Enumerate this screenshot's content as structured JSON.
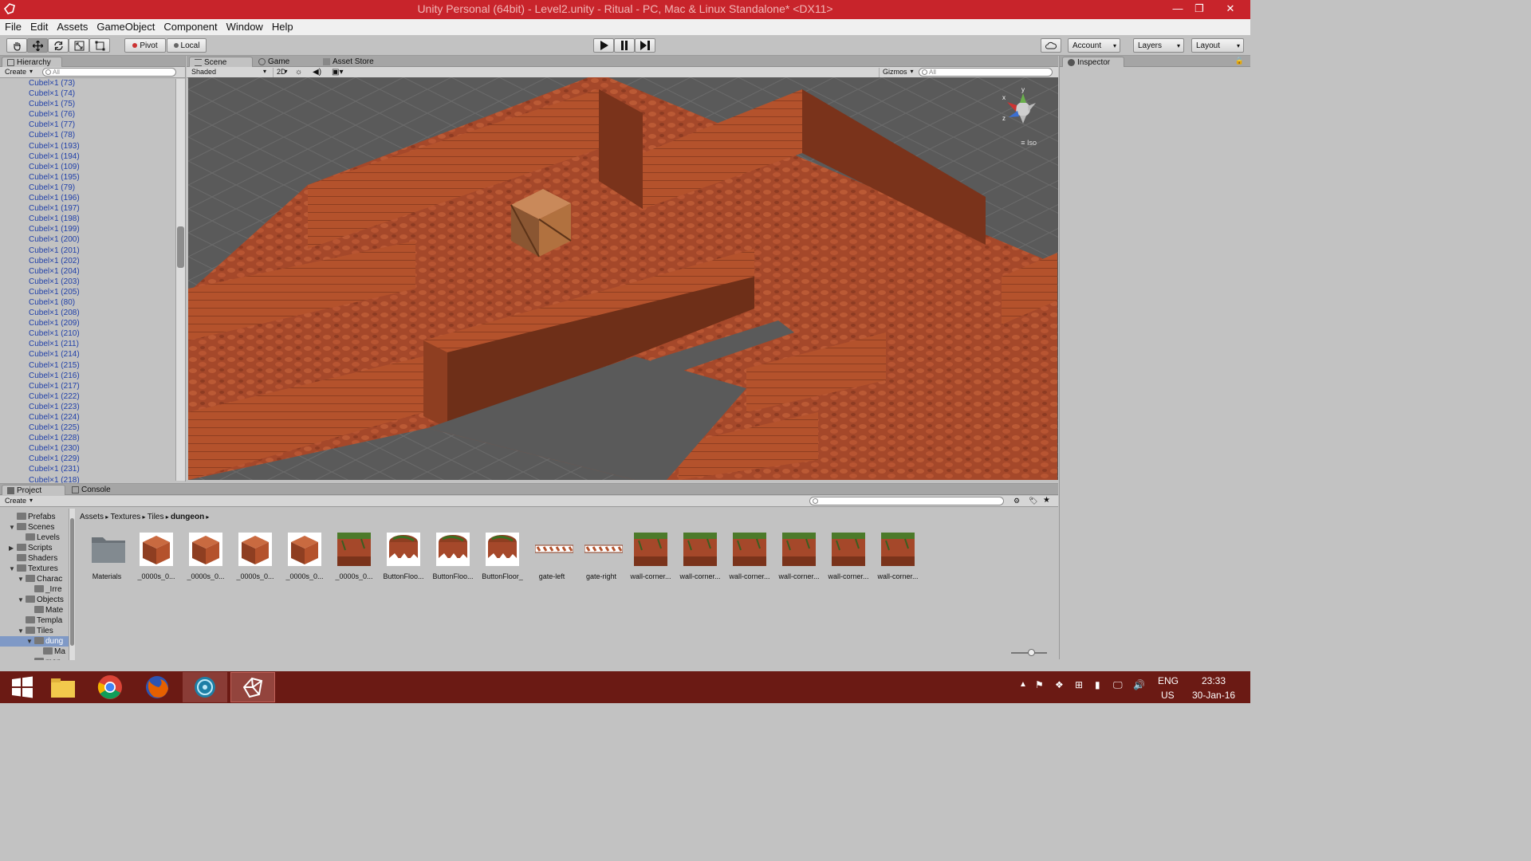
{
  "window": {
    "title": "Unity Personal (64bit) - Level2.unity - Ritual - PC, Mac & Linux Standalone* <DX11>",
    "minimize": "—",
    "maximize": "❐",
    "close": "✕"
  },
  "menu": [
    "File",
    "Edit",
    "Assets",
    "GameObject",
    "Component",
    "Window",
    "Help"
  ],
  "toolbar": {
    "pivot": "Pivot",
    "local": "Local",
    "account": "Account",
    "layers": "Layers",
    "layout": "Layout"
  },
  "hierarchy": {
    "tab": "Hierarchy",
    "create": "Create",
    "search_placeholder": "All",
    "items": [
      "Cubel×1 (73)",
      "Cubel×1 (74)",
      "Cubel×1 (75)",
      "Cubel×1 (76)",
      "Cubel×1 (77)",
      "Cubel×1 (78)",
      "Cubel×1 (193)",
      "Cubel×1 (194)",
      "Cubel×1 (109)",
      "Cubel×1 (195)",
      "Cubel×1 (79)",
      "Cubel×1 (196)",
      "Cubel×1 (197)",
      "Cubel×1 (198)",
      "Cubel×1 (199)",
      "Cubel×1 (200)",
      "Cubel×1 (201)",
      "Cubel×1 (202)",
      "Cubel×1 (204)",
      "Cubel×1 (203)",
      "Cubel×1 (205)",
      "Cubel×1 (80)",
      "Cubel×1 (208)",
      "Cubel×1 (209)",
      "Cubel×1 (210)",
      "Cubel×1 (211)",
      "Cubel×1 (214)",
      "Cubel×1 (215)",
      "Cubel×1 (216)",
      "Cubel×1 (217)",
      "Cubel×1 (222)",
      "Cubel×1 (223)",
      "Cubel×1 (224)",
      "Cubel×1 (225)",
      "Cubel×1 (228)",
      "Cubel×1 (230)",
      "Cubel×1 (229)",
      "Cubel×1 (231)",
      "Cubel×1 (218)"
    ]
  },
  "scene_view": {
    "tabs": [
      "Scene",
      "Game",
      "Asset Store"
    ],
    "shading": "Shaded",
    "mode_2d": "2D",
    "gizmos": "Gizmos",
    "search_placeholder": "All",
    "projection": "Iso",
    "axis_labels": {
      "x": "x",
      "y": "y",
      "z": "z"
    }
  },
  "inspector": {
    "tab": "Inspector"
  },
  "project": {
    "tabs": [
      "Project",
      "Console"
    ],
    "create": "Create",
    "tree": [
      {
        "label": "Prefabs",
        "indent": 1,
        "arrow": ""
      },
      {
        "label": "Scenes",
        "indent": 1,
        "arrow": "▼"
      },
      {
        "label": "Levels",
        "indent": 2,
        "arrow": ""
      },
      {
        "label": "Scripts",
        "indent": 1,
        "arrow": "▶"
      },
      {
        "label": "Shaders",
        "indent": 1,
        "arrow": ""
      },
      {
        "label": "Textures",
        "indent": 1,
        "arrow": "▼"
      },
      {
        "label": "Charac",
        "indent": 2,
        "arrow": "▼"
      },
      {
        "label": "_Irre",
        "indent": 3,
        "arrow": ""
      },
      {
        "label": "Objects",
        "indent": 2,
        "arrow": "▼"
      },
      {
        "label": "Mate",
        "indent": 3,
        "arrow": ""
      },
      {
        "label": "Templa",
        "indent": 2,
        "arrow": ""
      },
      {
        "label": "Tiles",
        "indent": 2,
        "arrow": "▼"
      },
      {
        "label": "dung",
        "indent": 3,
        "arrow": "▼",
        "selected": true
      },
      {
        "label": "Ma",
        "indent": 4,
        "arrow": ""
      },
      {
        "label": "man",
        "indent": 3,
        "arrow": "▼"
      }
    ],
    "breadcrumb": [
      "Assets",
      "Textures",
      "Tiles",
      "dungeon"
    ],
    "assets": [
      {
        "label": "Materials",
        "kind": "folder"
      },
      {
        "label": "_0000s_0...",
        "kind": "cube"
      },
      {
        "label": "_0000s_0...",
        "kind": "cube"
      },
      {
        "label": "_0000s_0...",
        "kind": "cube"
      },
      {
        "label": "_0000s_0...",
        "kind": "cube"
      },
      {
        "label": "_0000s_0...",
        "kind": "tile"
      },
      {
        "label": "ButtonFloo...",
        "kind": "button"
      },
      {
        "label": "ButtonFloo...",
        "kind": "button"
      },
      {
        "label": "ButtonFloor_",
        "kind": "button"
      },
      {
        "label": "gate-left",
        "kind": "gate"
      },
      {
        "label": "gate-right",
        "kind": "gate"
      },
      {
        "label": "wall-corner...",
        "kind": "tile"
      },
      {
        "label": "wall-corner...",
        "kind": "tile"
      },
      {
        "label": "wall-corner...",
        "kind": "tile"
      },
      {
        "label": "wall-corner...",
        "kind": "tile"
      },
      {
        "label": "wall-corner...",
        "kind": "tile"
      },
      {
        "label": "wall-corner...",
        "kind": "tile"
      }
    ]
  },
  "colors": {
    "titlebar": "#c8242b",
    "taskbar": "#6b1a14",
    "scene_bg": "#5a5a5a",
    "brick": "#b4522c",
    "hier_text": "#1f3fa8"
  },
  "taskbar": {
    "apps": [
      "windows-start",
      "file-explorer",
      "chrome",
      "firefox",
      "app-globe",
      "unity"
    ],
    "lang1": "ENG",
    "lang2": "US",
    "time": "23:33",
    "date": "30-Jan-16"
  }
}
